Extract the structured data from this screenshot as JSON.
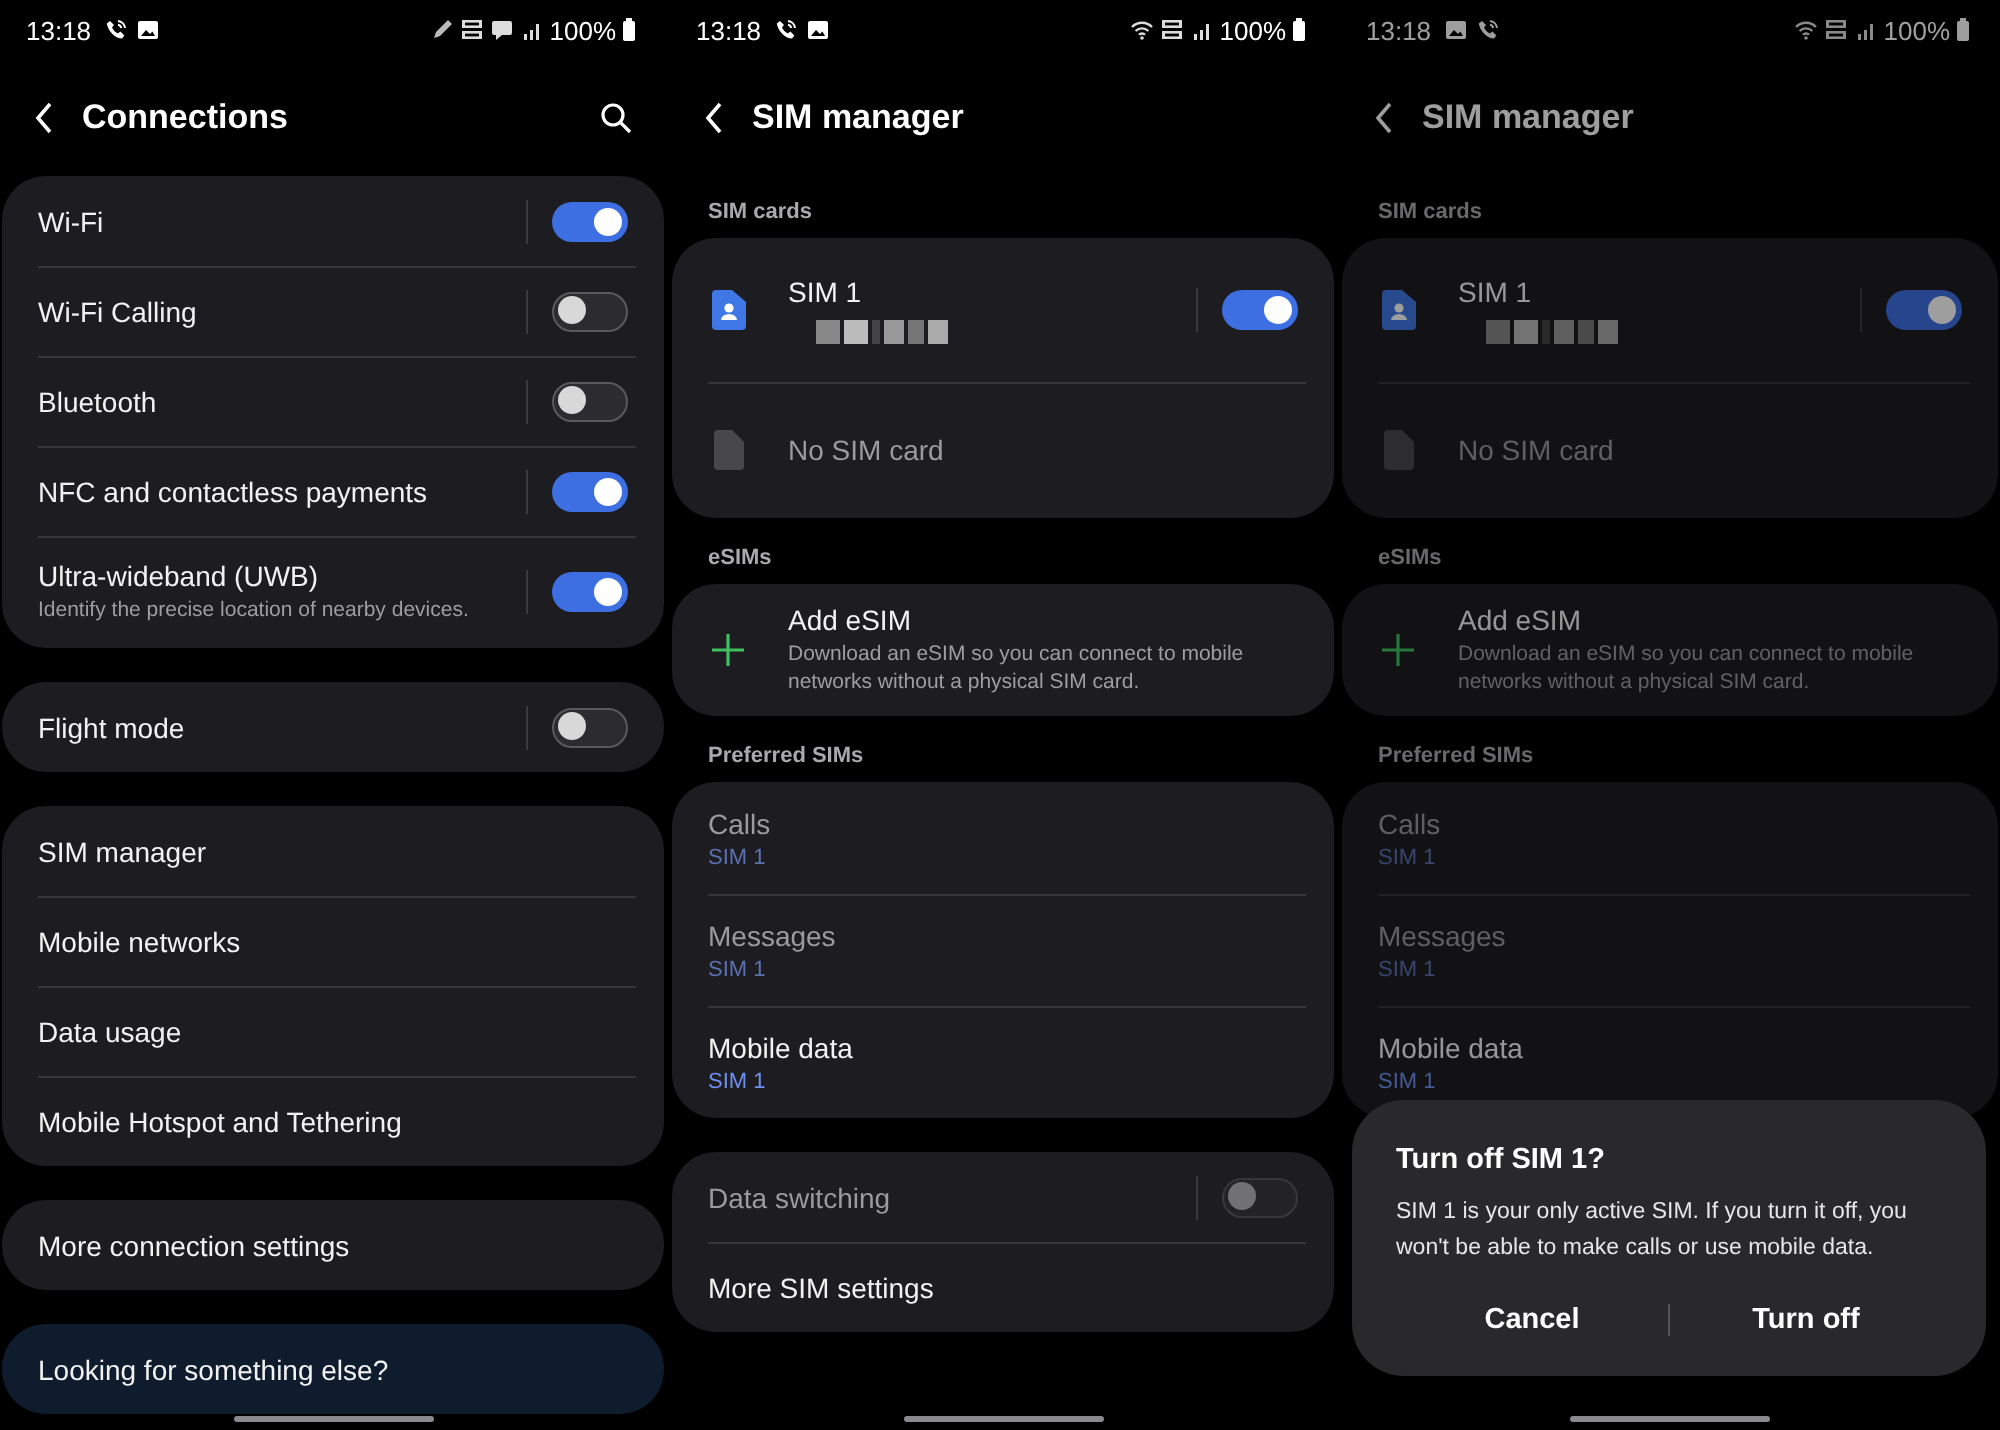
{
  "screens": [
    {
      "status_bar": {
        "time": "13:18",
        "left_icons": [
          {
            "kind": "wifi-call"
          },
          {
            "kind": "image"
          }
        ],
        "right_icons": [
          {
            "kind": "pen"
          },
          {
            "kind": "volte"
          },
          {
            "kind": "message"
          },
          {
            "kind": "signal"
          }
        ],
        "battery": "100%"
      },
      "header": {
        "title": "Connections",
        "actions": [
          {
            "kind": "search"
          }
        ]
      },
      "sections": [
        {
          "items": [
            {
              "kind": "toggle",
              "label": "Wi-Fi",
              "on": true
            },
            {
              "kind": "toggle",
              "label": "Wi-Fi Calling",
              "on": false
            },
            {
              "kind": "toggle",
              "label": "Bluetooth",
              "on": false
            },
            {
              "kind": "toggle",
              "label": "NFC and contactless payments",
              "on": true
            },
            {
              "kind": "toggle",
              "label": "Ultra-wideband (UWB)",
              "subtitle": "Identify the precise location of nearby devices.",
              "on": true
            }
          ]
        },
        {
          "items": [
            {
              "kind": "toggle",
              "label": "Flight mode",
              "on": false
            }
          ]
        },
        {
          "items": [
            {
              "kind": "link",
              "label": "SIM manager"
            },
            {
              "kind": "link",
              "label": "Mobile networks"
            },
            {
              "kind": "link",
              "label": "Data usage"
            },
            {
              "kind": "link",
              "label": "Mobile Hotspot and Tethering"
            }
          ]
        },
        {
          "items": [
            {
              "kind": "link",
              "label": "More connection settings"
            }
          ]
        },
        {
          "highlight": true,
          "items": [
            {
              "kind": "link",
              "label": "Looking for something else?"
            }
          ]
        }
      ]
    },
    {
      "status_bar": {
        "time": "13:18",
        "left_icons": [
          {
            "kind": "wifi-call"
          },
          {
            "kind": "image"
          }
        ],
        "right_icons": [
          {
            "kind": "wifi"
          },
          {
            "kind": "volte"
          },
          {
            "kind": "signal"
          }
        ],
        "battery": "100%"
      },
      "header": {
        "title": "SIM manager"
      },
      "sections": [
        {
          "heading": "SIM cards",
          "items": [
            {
              "kind": "sim",
              "label": "SIM 1",
              "redacted": true,
              "on": true
            },
            {
              "kind": "empty-slot",
              "label": "No SIM card"
            }
          ]
        },
        {
          "heading": "eSIMs",
          "items": [
            {
              "kind": "add",
              "label": "Add eSIM",
              "subtitle": "Download an eSIM so you can connect to mobile networks without a physical SIM card."
            }
          ]
        },
        {
          "heading": "Preferred SIMs",
          "items": [
            {
              "kind": "choice",
              "label": "Calls",
              "value": "SIM 1",
              "disabled": true
            },
            {
              "kind": "choice",
              "label": "Messages",
              "value": "SIM 1",
              "disabled": true
            },
            {
              "kind": "choice",
              "label": "Mobile data",
              "value": "SIM 1",
              "disabled": false
            }
          ]
        },
        {
          "items": [
            {
              "kind": "toggle",
              "label": "Data switching",
              "on": false,
              "disabled": true
            },
            {
              "kind": "link",
              "label": "More SIM settings",
              "disabled": false
            }
          ]
        }
      ]
    },
    {
      "status_bar": {
        "time": "13:18",
        "left_icons": [
          {
            "kind": "image"
          },
          {
            "kind": "wifi-call"
          }
        ],
        "right_icons": [
          {
            "kind": "wifi"
          },
          {
            "kind": "volte"
          },
          {
            "kind": "signal"
          }
        ],
        "battery": "100%"
      },
      "header": {
        "title": "SIM manager"
      },
      "sections": [
        {
          "heading": "SIM cards",
          "items": [
            {
              "kind": "sim",
              "label": "SIM 1",
              "redacted": true,
              "on": true
            },
            {
              "kind": "empty-slot",
              "label": "No SIM card"
            }
          ]
        },
        {
          "heading": "eSIMs",
          "items": [
            {
              "kind": "add",
              "label": "Add eSIM",
              "subtitle": "Download an eSIM so you can connect to mobile networks without a physical SIM card."
            }
          ]
        },
        {
          "heading": "Preferred SIMs",
          "items": [
            {
              "kind": "choice",
              "label": "Calls",
              "value": "SIM 1",
              "disabled": true
            },
            {
              "kind": "choice",
              "label": "Messages",
              "value": "SIM 1",
              "disabled": true
            },
            {
              "kind": "choice",
              "label": "Mobile data",
              "value": "SIM 1",
              "disabled": false
            }
          ]
        }
      ],
      "dialog": {
        "title": "Turn off SIM 1?",
        "message": "SIM 1 is your only active SIM. If you turn it off, you won't be able to make calls or use mobile data.",
        "buttons": [
          "Cancel",
          "Turn off"
        ]
      }
    }
  ]
}
